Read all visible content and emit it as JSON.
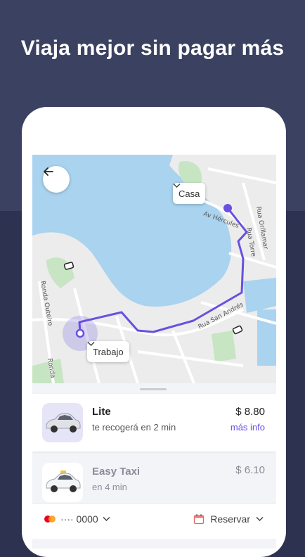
{
  "header": {
    "title": "Viaja mejor sin pagar más"
  },
  "map": {
    "destination_label": "Casa",
    "origin_label": "Trabajo",
    "street_labels": [
      "Av Hércules",
      "Rua Orillamar",
      "Rua Torre",
      "Rua San Andrés",
      "Ronda Outeiro",
      "Ronda"
    ],
    "route_color": "#6a4fe0"
  },
  "rides": [
    {
      "name": "Lite",
      "eta": "te recogerá en 2 min",
      "price": "$ 8.80",
      "more": "más info",
      "selected": true
    },
    {
      "name": "Easy Taxi",
      "eta": "en 4 min",
      "price": "$ 6.10",
      "selected": false
    }
  ],
  "footer": {
    "payment_label": "···· 0000",
    "reserve_label": "Reservar"
  },
  "colors": {
    "accent": "#6a4fe0",
    "background": "#2d3250"
  }
}
